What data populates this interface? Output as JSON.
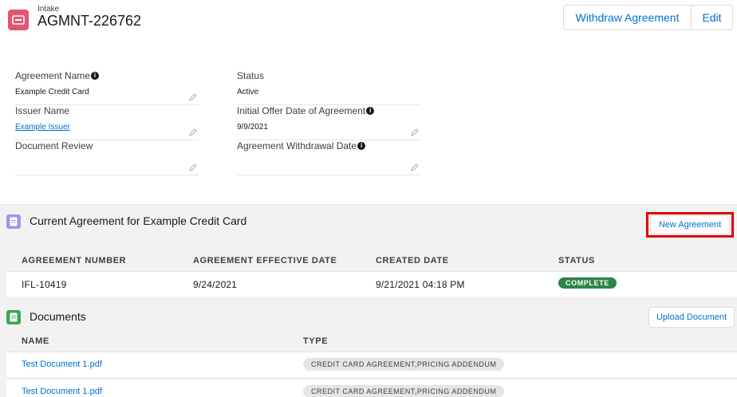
{
  "header": {
    "kicker": "Intake",
    "title": "AGMNT-226762",
    "withdraw_label": "Withdraw Agreement",
    "edit_label": "Edit",
    "icon_color": "#e3566f"
  },
  "fields": {
    "agreement_name": {
      "label": "Agreement Name",
      "value": "Example Credit Card"
    },
    "status": {
      "label": "Status",
      "value": "Active"
    },
    "issuer_name": {
      "label": "Issuer Name",
      "value": "Example Issuer"
    },
    "initial_offer_date": {
      "label": "Initial Offer Date of Agreement",
      "value": "9/9/2021"
    },
    "document_review": {
      "label": "Document Review",
      "value": ""
    },
    "withdrawal_date": {
      "label": "Agreement Withdrawal Date",
      "value": ""
    }
  },
  "current_agreement": {
    "title": "Current Agreement for Example Credit Card",
    "new_button": "New Agreement",
    "icon_color": "#a094ed",
    "columns": [
      "AGREEMENT NUMBER",
      "AGREEMENT EFFECTIVE DATE",
      "CREATED DATE",
      "STATUS"
    ],
    "rows": [
      {
        "number": "IFL-10419",
        "effective": "9/24/2021",
        "created": "9/21/2021 04:18 PM",
        "status": "COMPLETE"
      }
    ],
    "status_color": "#2e844a"
  },
  "documents": {
    "title": "Documents",
    "upload_button": "Upload Document",
    "icon_color": "#3ba755",
    "columns": [
      "NAME",
      "TYPE"
    ],
    "rows": [
      {
        "name": "Test Document 1.pdf",
        "type": "CREDIT CARD AGREEMENT,PRICING ADDENDUM"
      },
      {
        "name": "Test Document 1.pdf",
        "type": "CREDIT CARD AGREEMENT,PRICING ADDENDUM"
      }
    ]
  }
}
